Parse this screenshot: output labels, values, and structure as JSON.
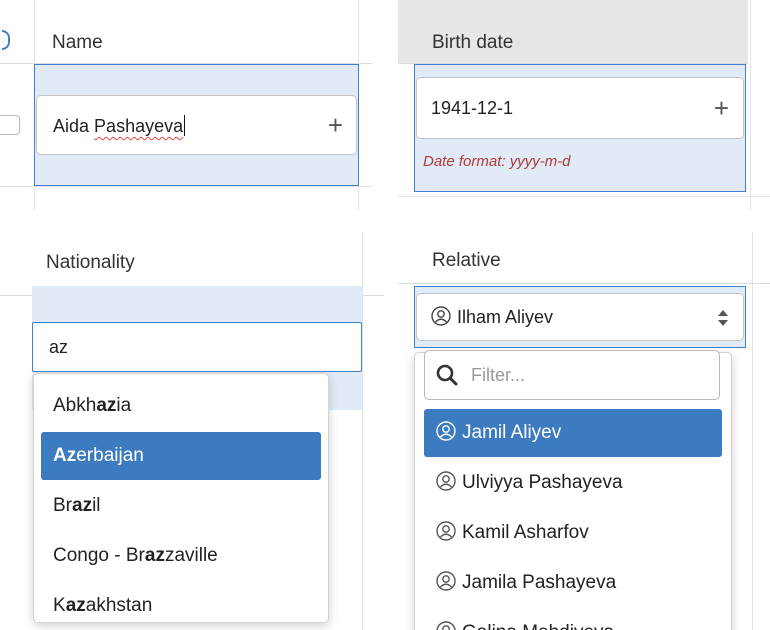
{
  "name_panel": {
    "header": "Name",
    "input_value_first": "Aida",
    "input_value_second": "Pashayeva",
    "plus_icon": "plus-icon"
  },
  "birth_panel": {
    "header": "Birth date",
    "input_value": "1941-12-1",
    "error": "Date format: yyyy-m-d",
    "plus_icon": "plus-icon"
  },
  "nationality_panel": {
    "header": "Nationality",
    "input_value": "az",
    "options": [
      {
        "pre": "Abkh",
        "match": "az",
        "post": "ia",
        "selected": false
      },
      {
        "pre": "",
        "match": "Az",
        "post": "erbaijan",
        "selected": true
      },
      {
        "pre": "Br",
        "match": "az",
        "post": "il",
        "selected": false
      },
      {
        "pre": "Congo - Br",
        "match": "az",
        "post": "zaville",
        "selected": false
      },
      {
        "pre": "K",
        "match": "az",
        "post": "akhstan",
        "selected": false
      }
    ]
  },
  "relative_panel": {
    "header": "Relative",
    "selected_value": "Ilham Aliyev",
    "filter_placeholder": "Filter...",
    "options": [
      {
        "label": "Jamil Aliyev",
        "selected": true
      },
      {
        "label": "Ulviyya Pashayeva",
        "selected": false
      },
      {
        "label": "Kamil Asharfov",
        "selected": false
      },
      {
        "label": "Jamila Pashayeva",
        "selected": false
      },
      {
        "label": "Galina Mehdiyeva",
        "selected": false
      }
    ]
  },
  "colors": {
    "accent": "#3c7bc0",
    "edit_cell_bg": "#e0ebf7",
    "error": "#b03a36"
  }
}
